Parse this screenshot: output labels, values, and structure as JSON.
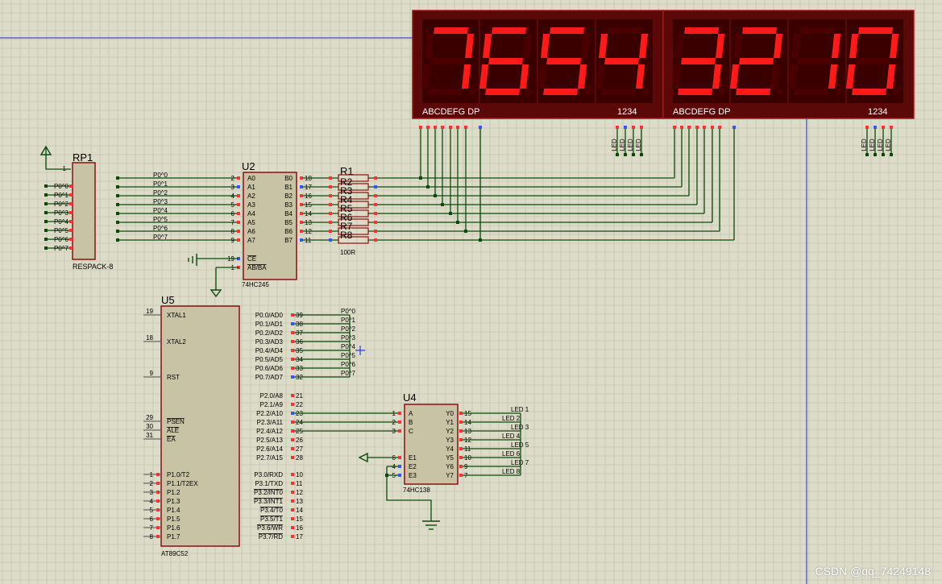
{
  "colors": {
    "background": "#dcdcc8",
    "grid": "#c5c5b0",
    "wire": "#0a4a0a",
    "chip_fill": "#c8c3a4",
    "chip_stroke": "#8a1010",
    "seg_on": "#ff1a1a",
    "seg_off": "#4a0000",
    "display_body": "#5a0808",
    "axis_blue": "#1a2ad0"
  },
  "display_left": {
    "digits": [
      "7",
      "6",
      "5",
      "4"
    ],
    "seg_label": "ABCDEFG  DP",
    "digit_label": "1234"
  },
  "display_right": {
    "digits": [
      "3",
      "2",
      "1",
      "0"
    ],
    "seg_label": "ABCDEFG  DP",
    "digit_label": "1234"
  },
  "led_labels": [
    "LED",
    "LED",
    "LED",
    "LED"
  ],
  "rp1": {
    "ref": "RP1",
    "part": "RESPACK-8",
    "pin1": "1",
    "nets": [
      "P0^0",
      "P0^1",
      "P0^2",
      "P0^3",
      "P0^4",
      "P0^5",
      "P0^6",
      "P0^7"
    ]
  },
  "u2": {
    "ref": "U2",
    "part": "74HC245",
    "in_nets": [
      "P0^0",
      "P0^1",
      "P0^2",
      "P0^3",
      "P0^4",
      "P0^5",
      "P0^6",
      "P0^7"
    ],
    "left_pins": [
      {
        "num": "2",
        "name": "A0"
      },
      {
        "num": "3",
        "name": "A1"
      },
      {
        "num": "4",
        "name": "A2"
      },
      {
        "num": "5",
        "name": "A3"
      },
      {
        "num": "6",
        "name": "A4"
      },
      {
        "num": "7",
        "name": "A5"
      },
      {
        "num": "8",
        "name": "A6"
      },
      {
        "num": "9",
        "name": "A7"
      }
    ],
    "right_pins": [
      {
        "num": "18",
        "name": "B0"
      },
      {
        "num": "17",
        "name": "B1"
      },
      {
        "num": "16",
        "name": "B2"
      },
      {
        "num": "15",
        "name": "B3"
      },
      {
        "num": "14",
        "name": "B4"
      },
      {
        "num": "13",
        "name": "B5"
      },
      {
        "num": "12",
        "name": "B6"
      },
      {
        "num": "11",
        "name": "B7"
      }
    ],
    "ctrl_pins": [
      {
        "num": "19",
        "name": "CE"
      },
      {
        "num": "1",
        "name": "AB/BA"
      }
    ]
  },
  "r1": {
    "ref": "R1",
    "part": "100R",
    "labels": [
      "R2",
      "R3",
      "R4",
      "R5",
      "R6",
      "R7",
      "R8"
    ]
  },
  "u5": {
    "ref": "U5",
    "part": "AT89C52",
    "left_top": [
      {
        "num": "19",
        "name": "XTAL1"
      },
      {
        "num": "18",
        "name": "XTAL2"
      },
      {
        "num": "9",
        "name": "RST"
      },
      {
        "num": "29",
        "name": "PSEN"
      },
      {
        "num": "30",
        "name": "ALE"
      },
      {
        "num": "31",
        "name": "EA"
      }
    ],
    "left_p1": [
      {
        "num": "1",
        "name": "P1.0/T2"
      },
      {
        "num": "2",
        "name": "P1.1/T2EX"
      },
      {
        "num": "3",
        "name": "P1.2"
      },
      {
        "num": "4",
        "name": "P1.3"
      },
      {
        "num": "5",
        "name": "P1.4"
      },
      {
        "num": "6",
        "name": "P1.5"
      },
      {
        "num": "7",
        "name": "P1.6"
      },
      {
        "num": "8",
        "name": "P1.7"
      }
    ],
    "right_p0": [
      {
        "num": "39",
        "name": "P0.0/AD0",
        "net": "P0^0"
      },
      {
        "num": "38",
        "name": "P0.1/AD1",
        "net": "P0^1"
      },
      {
        "num": "37",
        "name": "P0.2/AD2",
        "net": "P0^2"
      },
      {
        "num": "36",
        "name": "P0.3/AD3",
        "net": "P0^3"
      },
      {
        "num": "35",
        "name": "P0.4/AD4",
        "net": "P0^4"
      },
      {
        "num": "34",
        "name": "P0.5/AD5",
        "net": "P0^5"
      },
      {
        "num": "33",
        "name": "P0.6/AD6",
        "net": "P0^6"
      },
      {
        "num": "32",
        "name": "P0.7/AD7",
        "net": "P0^7"
      }
    ],
    "right_p2": [
      {
        "num": "21",
        "name": "P2.0/A8"
      },
      {
        "num": "22",
        "name": "P2.1/A9"
      },
      {
        "num": "23",
        "name": "P2.2/A10"
      },
      {
        "num": "24",
        "name": "P2.3/A11"
      },
      {
        "num": "25",
        "name": "P2.4/A12"
      },
      {
        "num": "26",
        "name": "P2.5/A13"
      },
      {
        "num": "27",
        "name": "P2.6/A14"
      },
      {
        "num": "28",
        "name": "P2.7/A15"
      }
    ],
    "right_p3": [
      {
        "num": "10",
        "name": "P3.0/RXD"
      },
      {
        "num": "11",
        "name": "P3.1/TXD"
      },
      {
        "num": "12",
        "name": "P3.2/INT0"
      },
      {
        "num": "13",
        "name": "P3.3/INT1"
      },
      {
        "num": "14",
        "name": "P3.4/T0"
      },
      {
        "num": "15",
        "name": "P3.5/T1"
      },
      {
        "num": "16",
        "name": "P3.6/WR"
      },
      {
        "num": "17",
        "name": "P3.7/RD"
      }
    ]
  },
  "u4": {
    "ref": "U4",
    "part": "74HC138",
    "in_pins": [
      {
        "num": "1",
        "name": "A"
      },
      {
        "num": "2",
        "name": "B"
      },
      {
        "num": "3",
        "name": "C"
      }
    ],
    "en_pins": [
      {
        "num": "6",
        "name": "E1"
      },
      {
        "num": "4",
        "name": "E2"
      },
      {
        "num": "5",
        "name": "E3"
      }
    ],
    "out_pins": [
      {
        "num": "15",
        "name": "Y0",
        "net": "LED 1"
      },
      {
        "num": "14",
        "name": "Y1",
        "net": "LED 2"
      },
      {
        "num": "13",
        "name": "Y2",
        "net": "LED 3"
      },
      {
        "num": "12",
        "name": "Y3",
        "net": "LED 4"
      },
      {
        "num": "11",
        "name": "Y4",
        "net": "LED 5"
      },
      {
        "num": "10",
        "name": "Y5",
        "net": "LED 6"
      },
      {
        "num": "9",
        "name": "Y6",
        "net": "LED 7"
      },
      {
        "num": "7",
        "name": "Y7",
        "net": "LED 8"
      }
    ]
  },
  "watermark": "CSDN @qq_74249148"
}
